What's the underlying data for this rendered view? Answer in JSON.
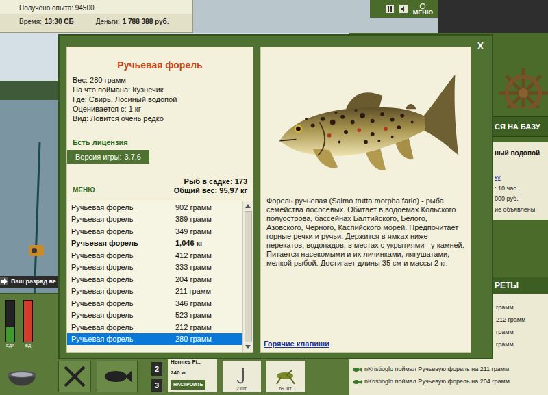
{
  "hud": {
    "experience": "Получено опыта: 94500",
    "time_label": "Время:",
    "time": "13:30 СБ",
    "money_label": "Деньги:",
    "money": "1 788 388 руб.",
    "menu": "МЕНЮ"
  },
  "scene": {
    "rank_notice": "Ваш разряд ве"
  },
  "side_panel": {
    "base_button": "СЯ НА БАЗУ",
    "location": "ный водопой",
    "link": "ку",
    "info": [
      ": 10 час.",
      "000 руб.",
      "ие объявлены"
    ],
    "section": "РЕТЫ",
    "feed": [
      {
        "text": "грамм",
        "kind": "partial"
      },
      {
        "text": "212 грамм",
        "kind": "partial"
      },
      {
        "text": "грамм",
        "kind": "partial"
      },
      {
        "text": "грамм",
        "kind": "partial"
      },
      {
        "text": "nKristioglo поймал Ручьевую форель на 211 грамм",
        "kind": "full"
      },
      {
        "text": "nKristioglo поймал Ручьевую форель на 204 грамм",
        "kind": "full"
      }
    ]
  },
  "toolbar": {
    "meters": [
      {
        "label": "ЕДА",
        "level": 0.35,
        "color": "#3f9a2c"
      },
      {
        "label": "ВД",
        "level": 1.0,
        "color": "#d63a2a"
      }
    ],
    "slots": [
      "2",
      "3"
    ],
    "reel": {
      "name": "Hermes Fi...",
      "load": "240 кг",
      "button": "НАСТРОИТЬ"
    },
    "hook_count": "2 шт.",
    "bait_count": "69 шт."
  },
  "dialog": {
    "close": "X",
    "title": "Ручьевая форель",
    "details": [
      "Вес: 280 грамм",
      "На что поймана: Кузнечик",
      "Где: Свирь, Лосиный водопой",
      "Оценивается с: 1 кг",
      "Вид: Ловится очень редко"
    ],
    "license": "Есть лицензия",
    "version_label": "Версия игры:",
    "version": "3.7.6",
    "menu": "МЕНЮ",
    "keepnet_count": "Рыб в садке: 173",
    "keepnet_weight": "Общий вес: 95,97 кг",
    "catches": [
      {
        "name": "Ручьевая форель",
        "weight": "902 грамм",
        "highlighted": false,
        "selected": false
      },
      {
        "name": "Ручьевая форель",
        "weight": "389 грамм",
        "highlighted": false,
        "selected": false
      },
      {
        "name": "Ручьевая форель",
        "weight": "349 грамм",
        "highlighted": false,
        "selected": false
      },
      {
        "name": "Ручьевая форель",
        "weight": "1,046 кг",
        "highlighted": true,
        "selected": false
      },
      {
        "name": "Ручьевая форель",
        "weight": "412 грамм",
        "highlighted": false,
        "selected": false
      },
      {
        "name": "Ручьевая форель",
        "weight": "333 грамм",
        "highlighted": false,
        "selected": false
      },
      {
        "name": "Ручьевая форель",
        "weight": "204 грамм",
        "highlighted": false,
        "selected": false
      },
      {
        "name": "Ручьевая форель",
        "weight": "211 грамм",
        "highlighted": false,
        "selected": false
      },
      {
        "name": "Ручьевая форель",
        "weight": "346 грамм",
        "highlighted": false,
        "selected": false
      },
      {
        "name": "Ручьевая форель",
        "weight": "523 грамм",
        "highlighted": false,
        "selected": false
      },
      {
        "name": "Ручьевая форель",
        "weight": "212 грамм",
        "highlighted": false,
        "selected": false
      },
      {
        "name": "Ручьевая форель",
        "weight": "280 грамм",
        "highlighted": false,
        "selected": true
      }
    ],
    "description": "Форель ручьевая (Salmo trutta morpha fario) - рыба семейства лососёвых. Обитает в водоёмах Кольского полуострова, бассейнах Балтийского, Белого, Азовского, Чёрного, Каспийского морей. Предпочитает горные речки и ручьи. Держится в ямках ниже перекатов, водопадов, в местах с укрытиями - у камней. Питается насекомыми и их личинками, лягушатами, мелкой рыбой. Достигает длины 35 см и массы 2 кг.",
    "hotkeys": "Горячие клавиши"
  }
}
